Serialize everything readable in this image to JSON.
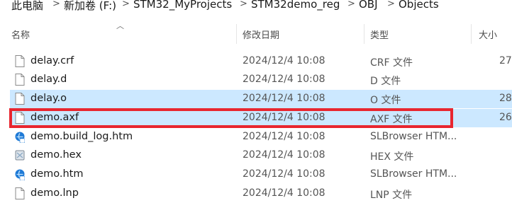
{
  "breadcrumb": {
    "items": [
      "此电脑",
      "新加卷 (F:)",
      "STM32_MyProjects",
      "STM32demo_reg",
      "OBJ",
      "Objects"
    ],
    "separator": ">"
  },
  "columns": {
    "name": "名称",
    "date": "修改日期",
    "type": "类型",
    "size": "大小"
  },
  "files": [
    {
      "name": "delay.crf",
      "date": "2024/12/4 10:08",
      "type": "CRF 文件",
      "size": "27",
      "icon": "blank-file-icon"
    },
    {
      "name": "delay.d",
      "date": "2024/12/4 10:08",
      "type": "D 文件",
      "size": "",
      "icon": "blank-file-icon"
    },
    {
      "name": "delay.o",
      "date": "2024/12/4 10:08",
      "type": "O 文件",
      "size": "28",
      "icon": "blank-file-icon"
    },
    {
      "name": "demo.axf",
      "date": "2024/12/4 10:08",
      "type": "AXF 文件",
      "size": "26",
      "icon": "blank-file-icon"
    },
    {
      "name": "demo.build_log.htm",
      "date": "2024/12/4 10:08",
      "type": "SLBrowser HTM...",
      "size": "",
      "icon": "browser-html-icon"
    },
    {
      "name": "demo.hex",
      "date": "2024/12/4 10:08",
      "type": "HEX 文件",
      "size": "",
      "icon": "hex-file-icon"
    },
    {
      "name": "demo.htm",
      "date": "2024/12/4 10:08",
      "type": "SLBrowser HTM...",
      "size": "",
      "icon": "browser-html-icon"
    },
    {
      "name": "demo.lnp",
      "date": "2024/12/4 10:08",
      "type": "LNP 文件",
      "size": "",
      "icon": "blank-file-icon"
    }
  ],
  "colors": {
    "selection": "#cce8ff",
    "highlight_box": "#e8262f"
  }
}
